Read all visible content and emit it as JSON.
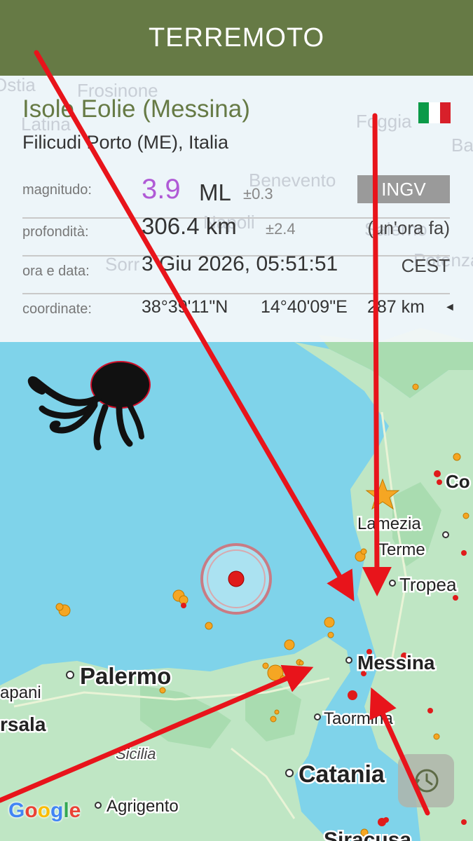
{
  "app": {
    "title": "TERREMOTO"
  },
  "event": {
    "region": "Isole Eolie (Messina)",
    "place": "Filicudi Porto (ME), Italia",
    "magnitude_label": "magnitudo:",
    "magnitude": "3.9",
    "magnitude_type": "ML",
    "magnitude_error": "±0.3",
    "agency": "INGV",
    "depth_label": "profondità:",
    "depth": "306.4 km",
    "depth_error": "±2.4",
    "time_ago": "(un'ora fa)",
    "datetime_label": "ora e data:",
    "datetime": "3 Giu 2026, 05:51:51",
    "timezone": "CEST",
    "coords_label": "coordinate:",
    "lat": "38°39'11\"N",
    "lon": "14°40'09\"E",
    "distance": "287 km"
  },
  "map": {
    "cities": {
      "palermo": "Palermo",
      "messina": "Messina",
      "catania": "Catania",
      "tropea": "Tropea",
      "lamezia": "Lamezia",
      "terme": "Terme",
      "taormina": "Taormina",
      "agrigento": "Agrigento",
      "sicilia": "Sicilia",
      "trapani": "apani",
      "marsala": "rsala",
      "cosenza": "Co",
      "siracusa": "Siracusa"
    },
    "bg_labels": {
      "frosinone": "Frosinone",
      "latina": "Latina",
      "foggia": "Foggia",
      "benevento": "Benevento",
      "napoli": "Napoli",
      "salerno": "Salerno",
      "potenza": "Potenza",
      "sorrento": "Sorr",
      "ba": "Ba",
      "ostia": "Ostia"
    },
    "attribution": "Google"
  },
  "colors": {
    "appbar": "#667a45",
    "sea": "#7fd3ea",
    "land": "#bfe6c4",
    "accent_magnitude": "#b05ad6",
    "arrow": "#e8141b",
    "quake_red": "#e01b1b",
    "quake_orange": "#f5a623"
  },
  "icons": {
    "flag": "italy-flag-icon",
    "history": "history-icon",
    "octopus": "octopus-logo",
    "star": "star-icon"
  }
}
